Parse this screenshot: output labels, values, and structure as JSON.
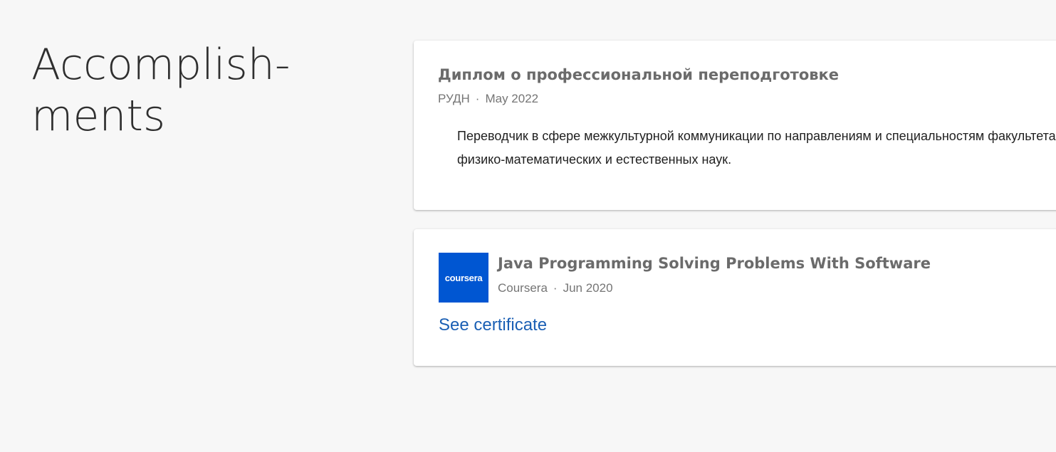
{
  "section": {
    "title_line1": "Accomplish-",
    "title_line2": "ments"
  },
  "items": [
    {
      "title": "Диплом о профессиональной переподготовке",
      "issuer": "РУДН",
      "separator": "·",
      "date": "May 2022",
      "description": "Переводчик в сфере межкультурной коммуникации по направлениям и специальностям факультета физико-математических и естественных наук."
    },
    {
      "logo_text": "coursera",
      "title": "Java Programming Solving Problems With Software",
      "issuer": "Coursera",
      "separator": "·",
      "date": "Jun 2020",
      "link_label": "See certificate"
    }
  ],
  "colors": {
    "background": "#f7f7f7",
    "card": "#ffffff",
    "title": "#6b6b6b",
    "link": "#1a5fb4",
    "coursera_brand": "#0056d2"
  }
}
